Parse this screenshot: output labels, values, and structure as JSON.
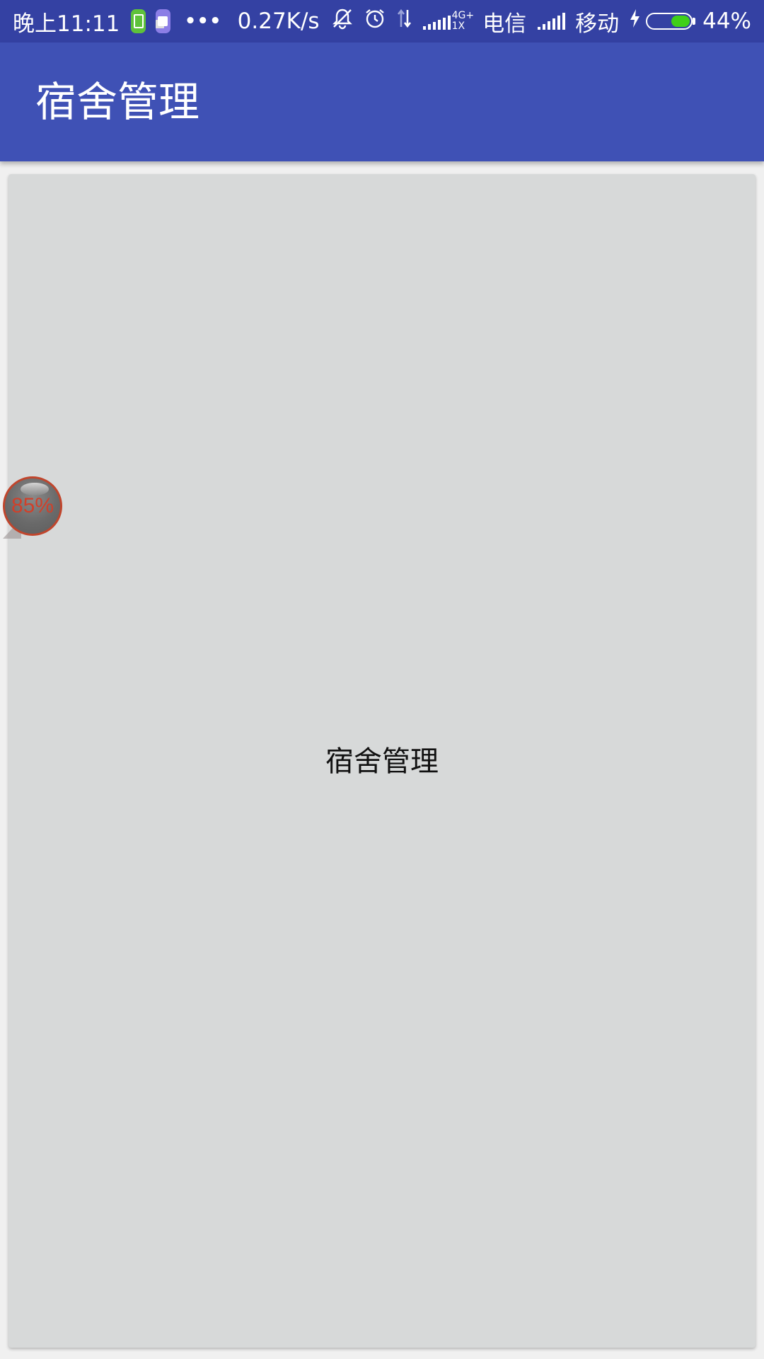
{
  "status_bar": {
    "time": "晚上11:11",
    "dots": "•••",
    "net_speed": "0.27K/s",
    "mute_icon": "bell-off-icon",
    "alarm_icon": "alarm-icon",
    "data_arrows_icon": "data-transfer-icon",
    "network_type_top": "4G+",
    "network_type_bottom": "1X",
    "carrier1": "电信",
    "carrier2": "移动",
    "battery_percent": "44%",
    "battery_level": 0.44,
    "battery_color": "#3fcf1a",
    "charging_icon": "lightning-icon"
  },
  "toolbar": {
    "title": "宿舍管理",
    "color": "#3f51b5"
  },
  "main": {
    "content_text": "宿舍管理"
  },
  "floating_ball": {
    "percent": "85%"
  }
}
